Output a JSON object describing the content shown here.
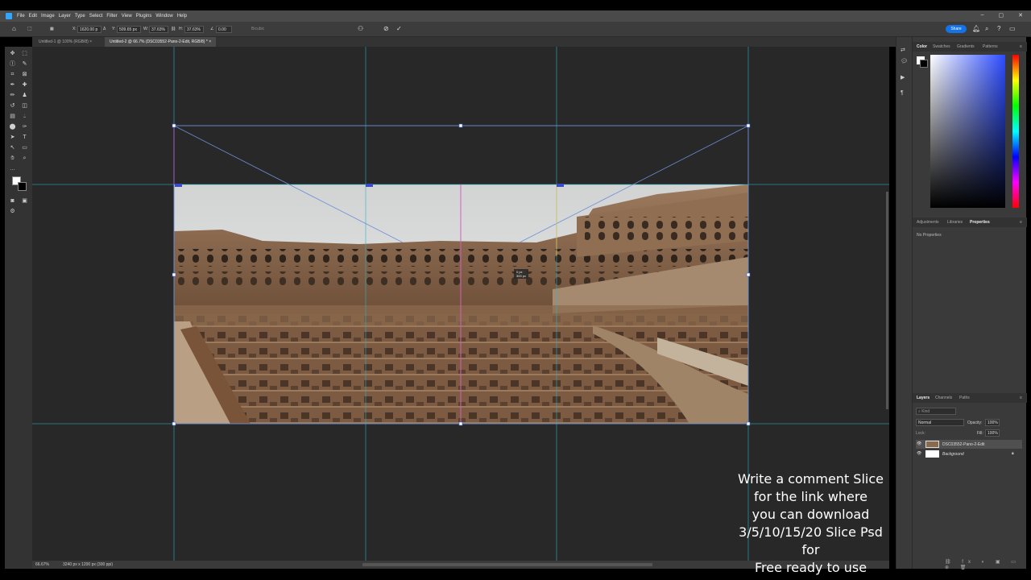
{
  "menubar": {
    "items": [
      "File",
      "Edit",
      "Image",
      "Layer",
      "Type",
      "Select",
      "Filter",
      "View",
      "Plugins",
      "Window",
      "Help"
    ],
    "window_controls": [
      "–",
      "▢",
      "✕"
    ]
  },
  "options": {
    "x_label": "X:",
    "x_value": "1620.00 p",
    "y_label": "Y:",
    "y_value": "509.65 px",
    "w_label": "W:",
    "w_value": "37.63%",
    "h_label": "H:",
    "h_value": "37.63%",
    "angle_value": "0.00",
    "interp_label": "Bicubic",
    "share_label": "Share"
  },
  "tabs": [
    {
      "label": "Untitled-1 @ 100% (RGB/8)",
      "active": false
    },
    {
      "label": "Untitled-2 @ 66.7% (DSC03552-Pano-2-Edit, RGB/8) *",
      "active": true
    }
  ],
  "transform_readout": {
    "line1": "0 px",
    "line2": "300 px"
  },
  "status": {
    "zoom": "66.67%",
    "doc_size": "3240 px x 1200 px (300 ppi)"
  },
  "color_panel": {
    "tabs": [
      "Color",
      "Swatches",
      "Gradients",
      "Patterns"
    ],
    "accent": "#1473e6"
  },
  "properties_panel": {
    "tabs": [
      "Adjustments",
      "Libraries",
      "Properties"
    ],
    "empty_text": "No Properties"
  },
  "layers_panel": {
    "tabs": [
      "Layers",
      "Channels",
      "Paths"
    ],
    "kind_placeholder": "Kind",
    "blend_mode": "Normal",
    "opacity_label": "Opacity:",
    "opacity_value": "100%",
    "lock_label": "Lock:",
    "fill_label": "Fill:",
    "fill_value": "100%",
    "layers": [
      {
        "name": "DSC03552-Pano-2-Edit",
        "selected": true
      },
      {
        "name": "Background",
        "selected": false
      }
    ]
  },
  "overlay": {
    "lines": [
      "Write a comment Slice",
      "for the link where",
      "you can download",
      "3/5/10/15/20 Slice Psd for",
      "Free ready to use"
    ]
  }
}
